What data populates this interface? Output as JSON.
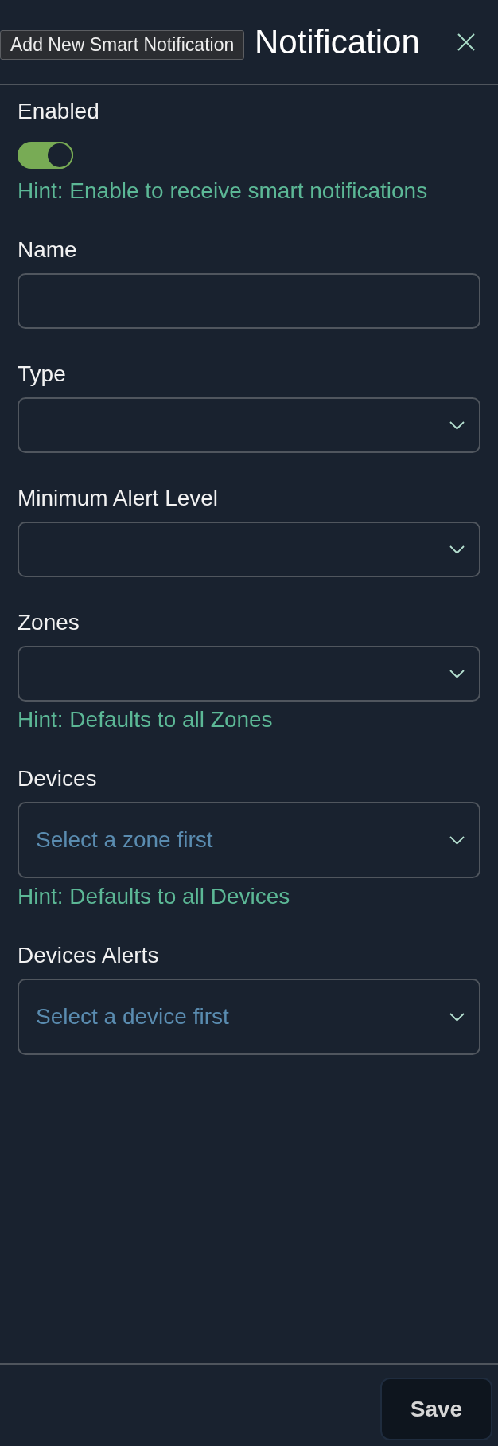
{
  "dialog": {
    "title": "Notification",
    "tooltip": "Add New Smart Notification"
  },
  "fields": [
    {
      "kind": "toggle",
      "label": "Enabled",
      "on": true,
      "hint": "Hint: Enable to receive smart notifications"
    },
    {
      "kind": "text",
      "label": "Name"
    },
    {
      "kind": "select",
      "label": "Type"
    },
    {
      "kind": "select",
      "label": "Minimum Alert Level"
    },
    {
      "kind": "select",
      "label": "Zones",
      "hint": "Hint: Defaults to all Zones"
    },
    {
      "kind": "select",
      "label": "Devices",
      "placeholder": "Select a zone first",
      "hint": "Hint: Defaults to all Devices"
    },
    {
      "kind": "select",
      "label": "Devices Alerts",
      "placeholder": "Select a device first"
    }
  ],
  "footer": {
    "buttons": [
      "Save"
    ]
  }
}
